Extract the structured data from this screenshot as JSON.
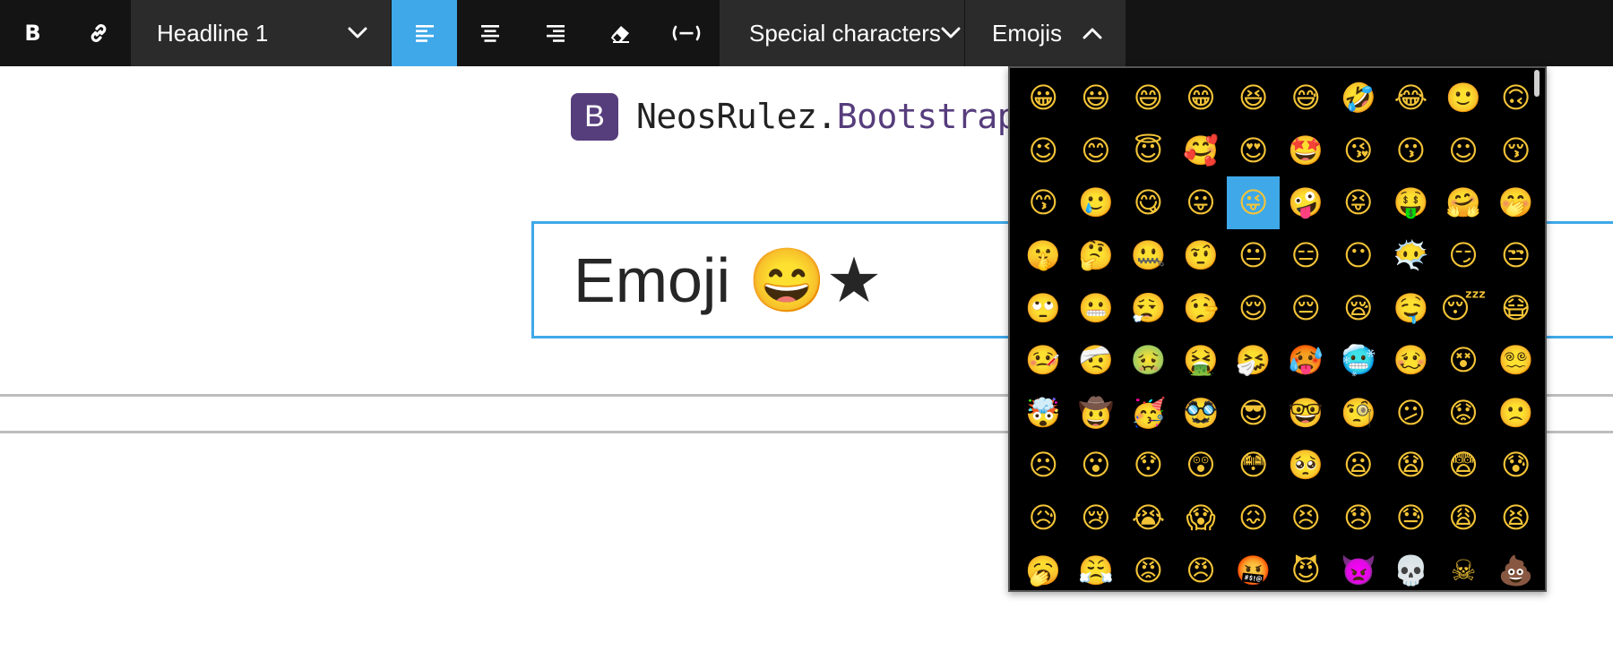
{
  "toolbar": {
    "bold_icon": "bold-icon",
    "link_icon": "link-icon",
    "heading_select": {
      "value": "Headline 1",
      "icon": "chevron-down-icon"
    },
    "align_left_icon": "align-left-icon",
    "align_center_icon": "align-center-icon",
    "align_right_icon": "align-right-icon",
    "remove_format_icon": "eraser-icon",
    "placeholder_icon": "placeholder-insert-icon",
    "special_characters": {
      "label": "Special characters",
      "icon": "chevron-down-icon"
    },
    "emojis": {
      "label": "Emojis",
      "icon": "chevron-up-icon",
      "expanded": true
    },
    "active_color": "#3fa8e8",
    "background_color": "#141414"
  },
  "content": {
    "brand_logo_letter": "B",
    "brand_name_prefix": "NeosRulez.",
    "brand_name_accent": "Bootstrap",
    "brand_color": "#563d7c",
    "headline_text": "Emoji 😄★",
    "focus_border_color": "#3fa8e8"
  },
  "emoji_picker": {
    "selected_index": 24,
    "emojis": [
      "😀",
      "😃",
      "😄",
      "😁",
      "😆",
      "😅",
      "🤣",
      "😂",
      "🙂",
      "🙃",
      "😉",
      "😊",
      "😇",
      "🥰",
      "😍",
      "🤩",
      "😘",
      "😗",
      "☺",
      "😚",
      "😙",
      "🥲",
      "😋",
      "😛",
      "😜",
      "🤪",
      "😝",
      "🤑",
      "🤗",
      "🤭",
      "🤫",
      "🤔",
      "🤐",
      "🤨",
      "😐",
      "😑",
      "😶",
      "😶‍🌫️",
      "😏",
      "😒",
      "🙄",
      "😬",
      "😮‍💨",
      "🤥",
      "😌",
      "😔",
      "😪",
      "🤤",
      "😴",
      "😷",
      "🤒",
      "🤕",
      "🤢",
      "🤮",
      "🤧",
      "🥵",
      "🥶",
      "🥴",
      "😵",
      "😵‍💫",
      "🤯",
      "🤠",
      "🥳",
      "🥸",
      "😎",
      "🤓",
      "🧐",
      "😕",
      "😟",
      "🙁",
      "☹",
      "😮",
      "😯",
      "😲",
      "😳",
      "🥺",
      "😦",
      "😧",
      "😨",
      "😰",
      "😥",
      "😢",
      "😭",
      "😱",
      "😖",
      "😣",
      "😞",
      "😓",
      "😩",
      "😫",
      "🥱",
      "😤",
      "😡",
      "😠",
      "🤬",
      "😈",
      "👿",
      "💀",
      "☠",
      "💩"
    ]
  }
}
